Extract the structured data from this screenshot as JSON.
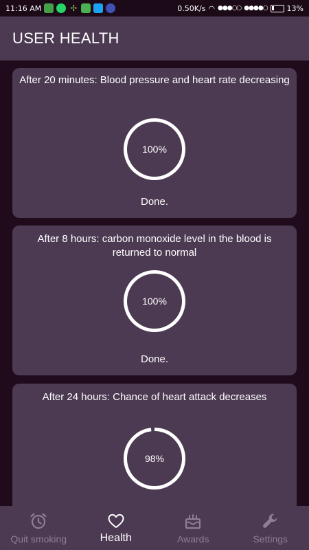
{
  "status_bar": {
    "time": "11:16 AM",
    "speed": "0.50K/s",
    "battery": "13%",
    "app_icons": [
      "green-app-icon",
      "whatsapp-icon",
      "plant-icon",
      "message-icon",
      "twitter-icon",
      "chat-icon"
    ],
    "app_icon_colors": [
      "#43a047",
      "#25d366",
      "#8bc34a",
      "#4caf50",
      "#1da1f2",
      "#3f51b5"
    ]
  },
  "header": {
    "title": "USER HEALTH"
  },
  "cards": [
    {
      "title": "After 20 minutes: Blood pressure and heart rate decreasing",
      "progress_label": "100%",
      "progress": 1.0,
      "status": "Done."
    },
    {
      "title": "After 8 hours: carbon monoxide level in the blood is returned to normal",
      "progress_label": "100%",
      "progress": 1.0,
      "status": "Done."
    },
    {
      "title": "After 24 hours: Chance of heart attack decreases",
      "progress_label": "98%",
      "progress": 0.98,
      "status": ""
    }
  ],
  "bottom_nav": {
    "items": [
      {
        "label": "Quit smoking",
        "icon": "alarm-clock-icon",
        "active": false
      },
      {
        "label": "Health",
        "icon": "heart-icon",
        "active": true
      },
      {
        "label": "Awards",
        "icon": "cake-icon",
        "active": false
      },
      {
        "label": "Settings",
        "icon": "wrench-icon",
        "active": false
      }
    ]
  },
  "colors": {
    "background": "#200b1c",
    "card": "#4c3a52",
    "inactive_nav": "#8f7d93",
    "ring": "#ffffff"
  }
}
